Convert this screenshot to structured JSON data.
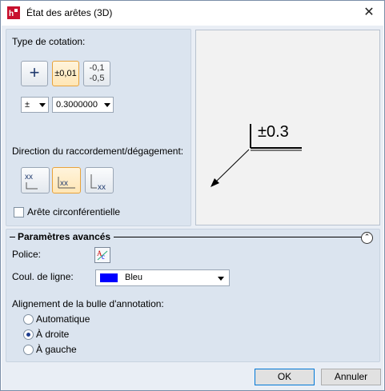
{
  "window": {
    "title": "État des arêtes (3D)",
    "close_glyph": "✕"
  },
  "left_panel": {
    "dim_type_label": "Type de cotation:",
    "dim_type_buttons": [
      {
        "label": "+",
        "active": false
      },
      {
        "label": "±0,01",
        "active": true
      },
      {
        "label_top": "-0,1",
        "label_bottom": "-0,5",
        "active": false
      }
    ],
    "sign_select": "±",
    "value_select": "0.3000000",
    "direction_label": "Direction du raccordement/dégagement:",
    "direction_buttons": [
      {
        "text": "xx",
        "active": false
      },
      {
        "text": "xx",
        "active": true
      },
      {
        "text": "xx",
        "active": false
      }
    ],
    "circ_edge_label": "Arête circonférentielle",
    "circ_edge_checked": false
  },
  "preview": {
    "annotation": "±0.3"
  },
  "advanced": {
    "title": "Paramètres avancés",
    "font_label": "Police:",
    "line_color_label": "Coul. de ligne:",
    "line_color_value": "Bleu",
    "line_color_hex": "#0000ff",
    "bubble_align_label": "Alignement de la bulle d'annotation:",
    "align_options": [
      {
        "label": "Automatique",
        "selected": false
      },
      {
        "label": "À droite",
        "selected": true
      },
      {
        "label": "À gauche",
        "selected": false
      }
    ]
  },
  "footer": {
    "ok_label": "OK",
    "cancel_label": "Annuler"
  }
}
